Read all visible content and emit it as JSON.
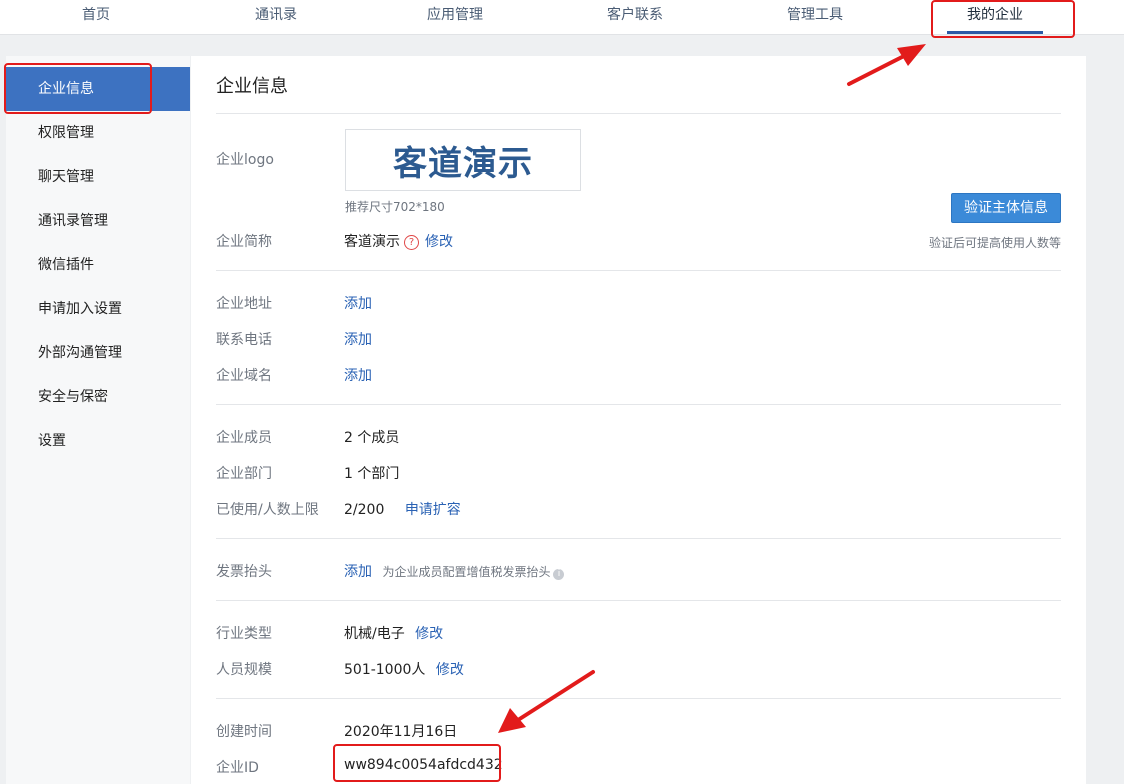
{
  "topnav": {
    "tabs": [
      {
        "label": "首页"
      },
      {
        "label": "通讯录"
      },
      {
        "label": "应用管理"
      },
      {
        "label": "客户联系"
      },
      {
        "label": "管理工具"
      },
      {
        "label": "我的企业"
      }
    ]
  },
  "sidebar": {
    "items": [
      {
        "label": "企业信息"
      },
      {
        "label": "权限管理"
      },
      {
        "label": "聊天管理"
      },
      {
        "label": "通讯录管理"
      },
      {
        "label": "微信插件"
      },
      {
        "label": "申请加入设置"
      },
      {
        "label": "外部沟通管理"
      },
      {
        "label": "安全与保密"
      },
      {
        "label": "设置"
      }
    ]
  },
  "main": {
    "title": "企业信息",
    "logo": {
      "label": "企业logo",
      "logo_text": "客道演示",
      "hint": "推荐尺寸702*180"
    },
    "verify": {
      "button": "验证主体信息",
      "hint": "验证后可提高使用人数等"
    },
    "short_name": {
      "label": "企业简称",
      "value": "客道演示",
      "help": "?",
      "action": "修改"
    },
    "address": {
      "label": "企业地址",
      "action": "添加"
    },
    "phone": {
      "label": "联系电话",
      "action": "添加"
    },
    "domain": {
      "label": "企业域名",
      "action": "添加"
    },
    "members": {
      "label": "企业成员",
      "value": "2 个成员"
    },
    "departments": {
      "label": "企业部门",
      "value": "1 个部门"
    },
    "usage": {
      "label": "已使用/人数上限",
      "value": "2/200",
      "action": "申请扩容"
    },
    "invoice": {
      "label": "发票抬头",
      "action": "添加",
      "hint": "为企业成员配置增值税发票抬头",
      "info": "i"
    },
    "industry": {
      "label": "行业类型",
      "value": "机械/电子",
      "action": "修改"
    },
    "scale": {
      "label": "人员规模",
      "value": "501-1000人",
      "action": "修改"
    },
    "created": {
      "label": "创建时间",
      "value": "2020年11月16日"
    },
    "corp_id": {
      "label": "企业ID",
      "value": "ww894c0054afdcd432"
    }
  },
  "colors": {
    "accent": "#3d72c1",
    "link": "#2a62b4",
    "annotation": "#e21b1b"
  }
}
